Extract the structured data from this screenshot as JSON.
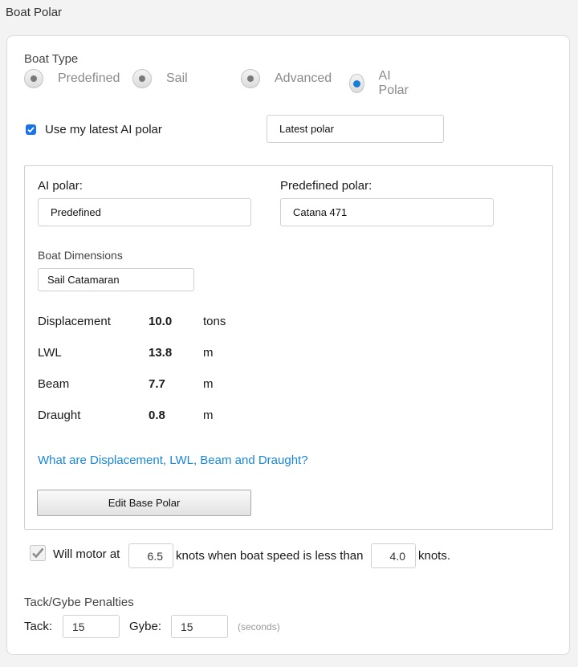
{
  "page": {
    "title": "Boat Polar"
  },
  "boat_type": {
    "label": "Boat Type",
    "options": [
      "Predefined",
      "Sail",
      "Advanced",
      "AI Polar"
    ],
    "selected": "AI Polar"
  },
  "latest_ai": {
    "checkbox_label": "Use my latest AI polar",
    "checked": true,
    "select_value": "Latest polar"
  },
  "polar": {
    "ai_label": "AI polar:",
    "ai_value": "Predefined",
    "predefined_label": "Predefined polar:",
    "predefined_value": "Catana 471"
  },
  "dimensions": {
    "label": "Boat Dimensions",
    "type_value": "Sail Catamaran",
    "rows": [
      {
        "name": "Displacement",
        "value": "10.0",
        "unit": "tons"
      },
      {
        "name": "LWL",
        "value": "13.8",
        "unit": "m"
      },
      {
        "name": "Beam",
        "value": "7.7",
        "unit": "m"
      },
      {
        "name": "Draught",
        "value": "0.8",
        "unit": "m"
      }
    ],
    "help_link": "What are Displacement, LWL, Beam and Draught?",
    "edit_button": "Edit Base Polar"
  },
  "motor": {
    "text_prefix": "Will motor at",
    "speed_value": "6.5",
    "text_middle": "knots when boat speed is less than",
    "threshold_value": "4.0",
    "text_suffix": "knots.",
    "checked": true
  },
  "penalties": {
    "label": "Tack/Gybe Penalties",
    "tack_label": "Tack:",
    "tack_value": "15",
    "gybe_label": "Gybe:",
    "gybe_value": "15",
    "unit": "(seconds)"
  }
}
